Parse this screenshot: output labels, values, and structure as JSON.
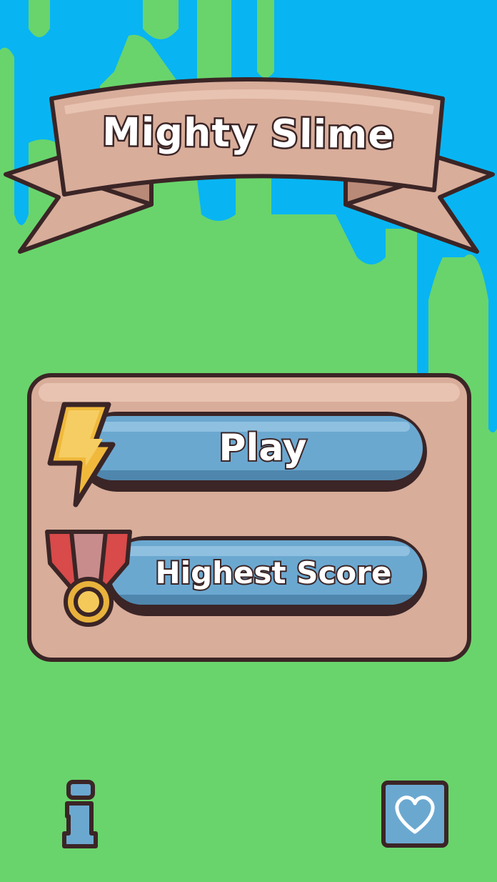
{
  "game": {
    "title": "Mighty Slime",
    "menu": {
      "play_label": "Play",
      "highest_score_label": "Highest Score"
    }
  },
  "icons": {
    "play": "lightning-icon",
    "score": "medal-icon",
    "info": "info-icon",
    "favorite": "heart-icon"
  },
  "colors": {
    "grass": "#69d46c",
    "sky": "#08b5f2",
    "banner": "#d8ad9a",
    "button": "#6ba8d0",
    "outline": "#3b2526"
  }
}
